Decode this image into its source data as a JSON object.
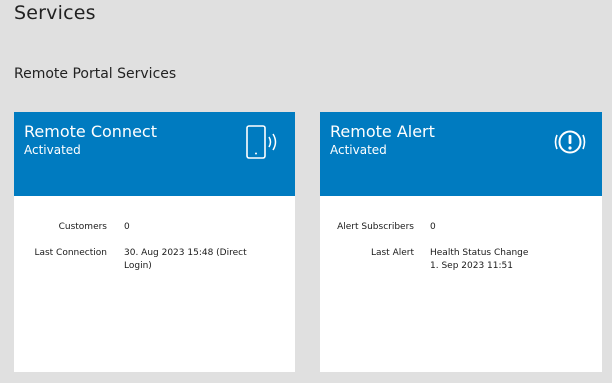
{
  "page": {
    "title": "Services"
  },
  "section": {
    "title": "Remote Portal Services"
  },
  "cards": [
    {
      "name": "Remote Connect",
      "status": "Activated",
      "icon": "mobile-wireless-icon",
      "rows": [
        {
          "label": "Customers",
          "value": "0"
        },
        {
          "label": "Last Connection",
          "value": "30. Aug 2023 15:48 (Direct\nLogin)"
        }
      ]
    },
    {
      "name": "Remote Alert",
      "status": "Activated",
      "icon": "alert-signal-icon",
      "rows": [
        {
          "label": "Alert Subscribers",
          "value": "0"
        },
        {
          "label": "Last Alert",
          "value": "Health Status Change\n1. Sep 2023 11:51"
        }
      ]
    }
  ],
  "colors": {
    "header": "#007bc0",
    "background": "#e0e0e0",
    "card": "#ffffff"
  }
}
